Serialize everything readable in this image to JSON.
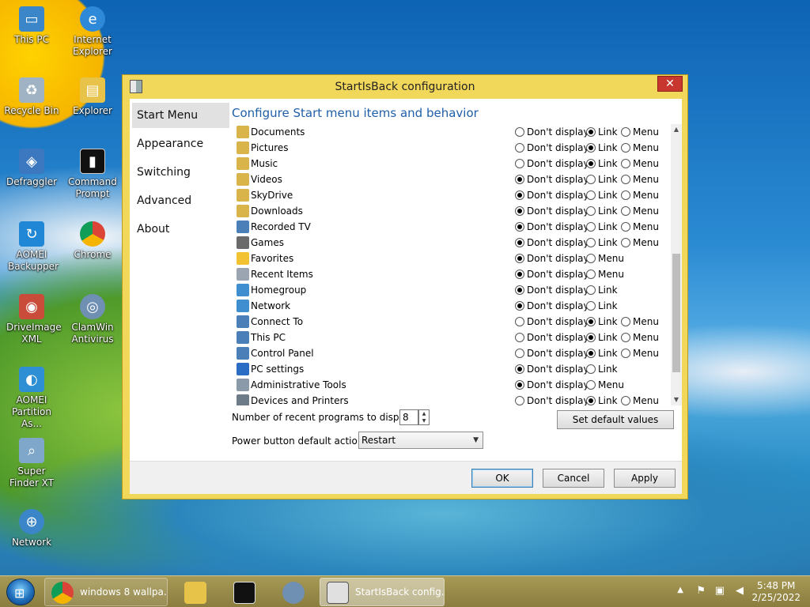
{
  "desktop": {
    "icons": [
      {
        "label": "This PC",
        "icon": "computer-icon"
      },
      {
        "label": "Internet Explorer",
        "icon": "ie-icon"
      },
      {
        "label": "Recycle Bin",
        "icon": "recycle-bin-icon"
      },
      {
        "label": "Explorer",
        "icon": "folder-icon"
      },
      {
        "label": "Defraggler",
        "icon": "defraggler-icon"
      },
      {
        "label": "Command Prompt",
        "icon": "terminal-icon"
      },
      {
        "label": "AOMEI Backupper",
        "icon": "backup-icon"
      },
      {
        "label": "Chrome",
        "icon": "chrome-icon"
      },
      {
        "label": "DriveImage XML",
        "icon": "disk-image-icon"
      },
      {
        "label": "ClamWin Antivirus",
        "icon": "antivirus-icon"
      },
      {
        "label": "AOMEI Partition As...",
        "icon": "partition-icon"
      },
      {
        "label": "Super Finder XT",
        "icon": "search-icon"
      },
      {
        "label": "Network",
        "icon": "network-icon"
      }
    ]
  },
  "window": {
    "title": "StartIsBack configuration",
    "close_glyph": "✕"
  },
  "nav": {
    "items": [
      {
        "label": "Start Menu",
        "active": true
      },
      {
        "label": "Appearance",
        "active": false
      },
      {
        "label": "Switching",
        "active": false
      },
      {
        "label": "Advanced",
        "active": false
      },
      {
        "label": "About",
        "active": false
      }
    ]
  },
  "main": {
    "heading": "Configure Start menu items and behavior",
    "option_labels": {
      "dont": "Don't display",
      "link": "Link",
      "menu": "Menu"
    },
    "items": [
      {
        "label": "Documents",
        "icon": "documents-icon",
        "color": "#d9b44a",
        "options": [
          "dont",
          "link",
          "menu"
        ],
        "selected": "link"
      },
      {
        "label": "Pictures",
        "icon": "pictures-icon",
        "color": "#d9b44a",
        "options": [
          "dont",
          "link",
          "menu"
        ],
        "selected": "link"
      },
      {
        "label": "Music",
        "icon": "music-icon",
        "color": "#d9b44a",
        "options": [
          "dont",
          "link",
          "menu"
        ],
        "selected": "link"
      },
      {
        "label": "Videos",
        "icon": "videos-icon",
        "color": "#d9b44a",
        "options": [
          "dont",
          "link",
          "menu"
        ],
        "selected": "dont"
      },
      {
        "label": "SkyDrive",
        "icon": "skydrive-icon",
        "color": "#d9b44a",
        "options": [
          "dont",
          "link",
          "menu"
        ],
        "selected": "dont"
      },
      {
        "label": "Downloads",
        "icon": "downloads-icon",
        "color": "#d9b44a",
        "options": [
          "dont",
          "link",
          "menu"
        ],
        "selected": "dont"
      },
      {
        "label": "Recorded TV",
        "icon": "tv-icon",
        "color": "#4a7fb8",
        "options": [
          "dont",
          "link",
          "menu"
        ],
        "selected": "dont"
      },
      {
        "label": "Games",
        "icon": "games-icon",
        "color": "#6a6a6a",
        "options": [
          "dont",
          "link",
          "menu"
        ],
        "selected": "dont"
      },
      {
        "label": "Favorites",
        "icon": "favorites-icon",
        "color": "#f2c233",
        "options": [
          "dont",
          "menu"
        ],
        "selected": "dont"
      },
      {
        "label": "Recent Items",
        "icon": "recent-items-icon",
        "color": "#9aa5b1",
        "options": [
          "dont",
          "menu"
        ],
        "selected": "dont"
      },
      {
        "label": "Homegroup",
        "icon": "homegroup-icon",
        "color": "#3f8fd0",
        "options": [
          "dont",
          "link"
        ],
        "selected": "dont"
      },
      {
        "label": "Network",
        "icon": "network-icon",
        "color": "#3f8fd0",
        "options": [
          "dont",
          "link"
        ],
        "selected": "dont"
      },
      {
        "label": "Connect To",
        "icon": "connect-to-icon",
        "color": "#4a7fb8",
        "options": [
          "dont",
          "link",
          "menu"
        ],
        "selected": "link"
      },
      {
        "label": "This PC",
        "icon": "computer-icon",
        "color": "#4a7fb8",
        "options": [
          "dont",
          "link",
          "menu"
        ],
        "selected": "link"
      },
      {
        "label": "Control Panel",
        "icon": "control-panel-icon",
        "color": "#4a7fb8",
        "options": [
          "dont",
          "link",
          "menu"
        ],
        "selected": "link"
      },
      {
        "label": "PC settings",
        "icon": "gear-icon",
        "color": "#2b6cc4",
        "options": [
          "dont",
          "link"
        ],
        "selected": "dont"
      },
      {
        "label": "Administrative Tools",
        "icon": "admin-tools-icon",
        "color": "#8a9aa8",
        "options": [
          "dont",
          "menu"
        ],
        "selected": "dont"
      },
      {
        "label": "Devices and Printers",
        "icon": "printer-icon",
        "color": "#6d7a88",
        "options": [
          "dont",
          "link",
          "menu"
        ],
        "selected": "link"
      }
    ],
    "recent_label": "Number of recent programs to display:",
    "recent_value": "8",
    "power_label": "Power button default action:",
    "power_value": "Restart",
    "set_default_label": "Set default values"
  },
  "footer": {
    "ok": "OK",
    "cancel": "Cancel",
    "apply": "Apply"
  },
  "taskbar": {
    "buttons": [
      {
        "label": "windows 8 wallpa...",
        "icon": "chrome-icon",
        "active": false
      },
      {
        "label": "",
        "icon": "file-explorer-icon",
        "active": false
      },
      {
        "label": "",
        "icon": "terminal-icon",
        "active": false
      },
      {
        "label": "",
        "icon": "antivirus-icon",
        "active": false
      },
      {
        "label": "StartIsBack config...",
        "icon": "startisback-icon",
        "active": true
      }
    ],
    "time": "5:48 PM",
    "date": "2/25/2022"
  }
}
